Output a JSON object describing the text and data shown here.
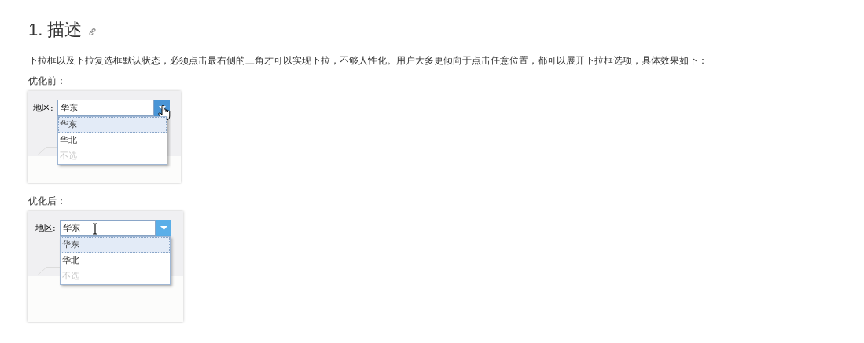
{
  "heading": {
    "number": "1.",
    "title": "描述"
  },
  "description": "下拉框以及下拉复选框默认状态，必须点击最右侧的三角才可以实现下拉，不够人性化。用户大多更倾向于点击任意位置，都可以展开下拉框选项，具体效果如下：",
  "examples": [
    {
      "caption": "优化前：",
      "label": "地区:",
      "value": "华东",
      "cursor": {
        "kind": "hand"
      },
      "options": [
        {
          "text": "华东",
          "selected": true,
          "disabled": false
        },
        {
          "text": "华北",
          "selected": false,
          "disabled": false
        },
        {
          "text": "不选",
          "selected": false,
          "disabled": true
        }
      ]
    },
    {
      "caption": "优化后：",
      "label": "地区:",
      "value": "华东",
      "cursor": {
        "kind": "text"
      },
      "options": [
        {
          "text": "华东",
          "selected": true,
          "disabled": false
        },
        {
          "text": "华北",
          "selected": false,
          "disabled": false
        },
        {
          "text": "不选",
          "selected": false,
          "disabled": true
        }
      ]
    }
  ]
}
